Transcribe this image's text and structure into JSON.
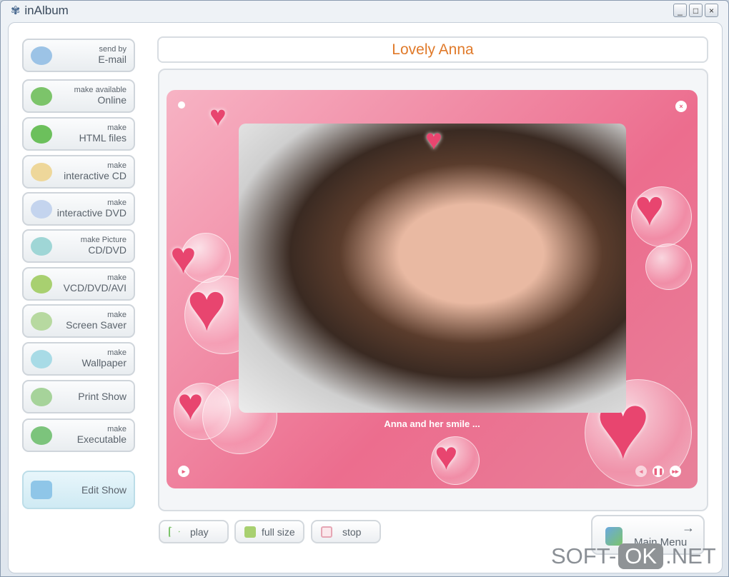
{
  "window": {
    "title": "inAlbum",
    "controls": [
      "_",
      "□",
      "×"
    ]
  },
  "sidebar": {
    "buttons": [
      {
        "small": "send by",
        "big": "E-mail",
        "icon": "email-icon",
        "color": "#9cc3e6"
      },
      {
        "small": "make available",
        "big": "Online",
        "icon": "globe-icon",
        "color": "#7cc46a"
      },
      {
        "small": "make",
        "big": "HTML files",
        "icon": "html-icon",
        "color": "#6cc05c"
      },
      {
        "small": "make",
        "big": "interactive CD",
        "icon": "cd-icon",
        "color": "#eed79a"
      },
      {
        "small": "make",
        "big": "interactive DVD",
        "icon": "dvd-icon",
        "color": "#c4d4ee"
      },
      {
        "small": "make Picture",
        "big": "CD/DVD",
        "icon": "picture-cd-icon",
        "color": "#9fd6d6"
      },
      {
        "small": "make",
        "big": "VCD/DVD/AVI",
        "icon": "video-icon",
        "color": "#a8d070"
      },
      {
        "small": "make",
        "big": "Screen Saver",
        "icon": "screensaver-icon",
        "color": "#b7d9a0"
      },
      {
        "small": "make",
        "big": "Wallpaper",
        "icon": "wallpaper-icon",
        "color": "#a8dbe6"
      },
      {
        "small": "",
        "big": "Print Show",
        "icon": "printer-icon",
        "color": "#a6d39a"
      },
      {
        "small": "make",
        "big": "Executable",
        "icon": "executable-icon",
        "color": "#7cc47c"
      }
    ],
    "edit": {
      "label": "Edit Show",
      "icon": "edit-show-icon"
    }
  },
  "show": {
    "title": "Lovely Anna",
    "caption": "Anna and her smile ..."
  },
  "playback": {
    "play": "play",
    "full_size": "full size",
    "stop": "stop"
  },
  "main_menu": {
    "label": "Main Menu",
    "arrow": "→"
  },
  "watermark": {
    "left": "SOFT-",
    "mid": "OK",
    "right": ".NET"
  },
  "colors": {
    "title": "#e07a2a",
    "frame": "#ec6d8e"
  }
}
